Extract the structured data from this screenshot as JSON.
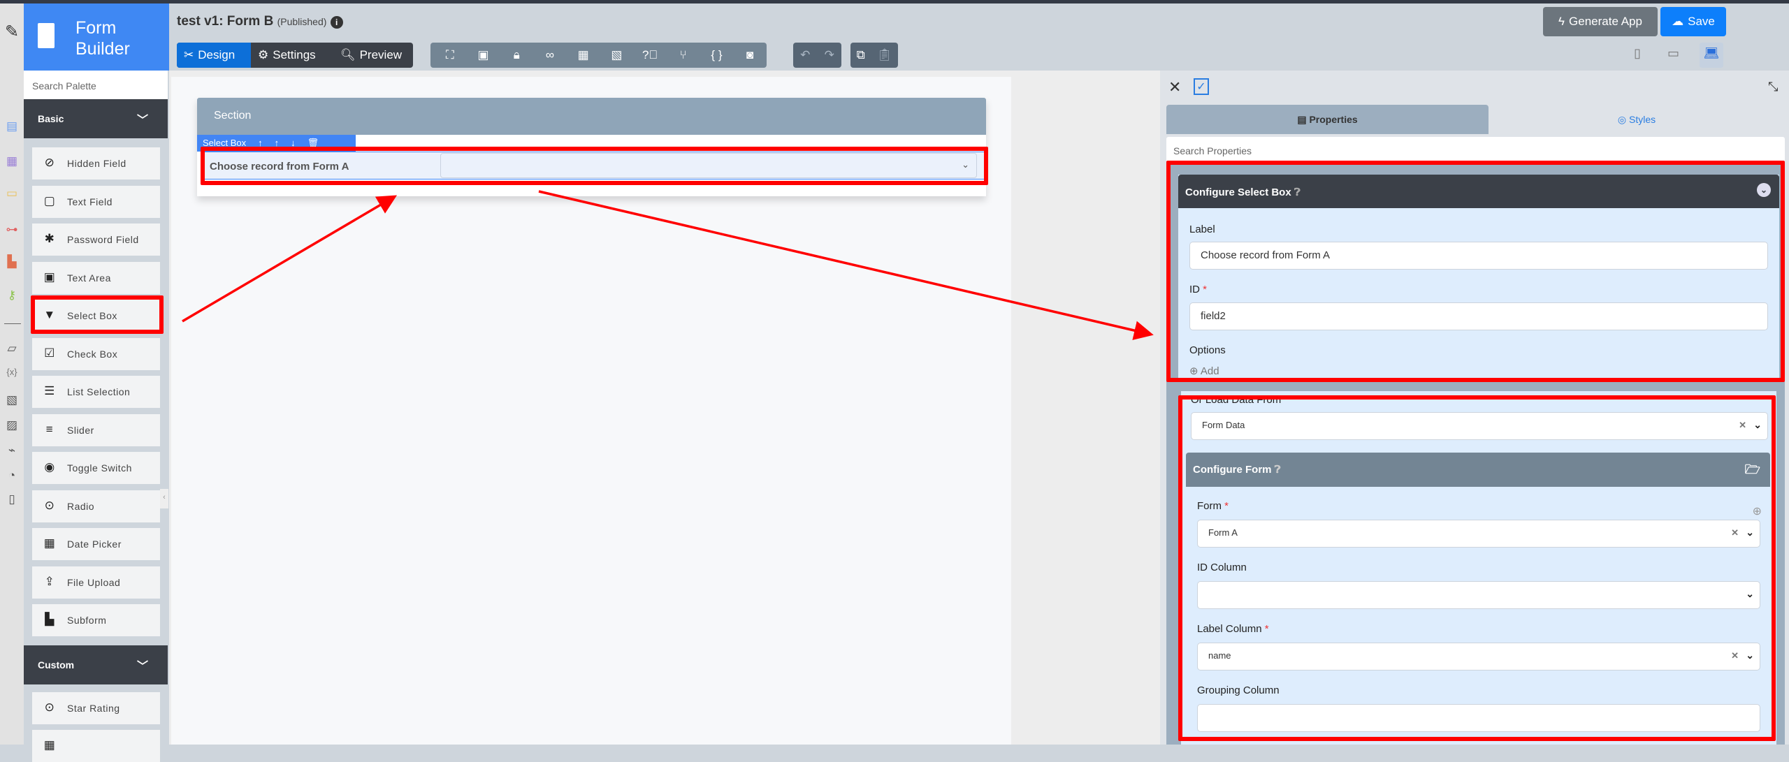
{
  "app": {
    "name_line1": "Form",
    "name_line2": "Builder",
    "title": "test v1: Form B",
    "status": "(Published)"
  },
  "header": {
    "modes": [
      "Design",
      "Settings",
      "Preview"
    ],
    "generate_label": "Generate App",
    "save_label": "Save"
  },
  "toolbar_icons": [
    "tree-icon",
    "properties-icon",
    "lock-icon",
    "binoculars-icon",
    "grid-icon",
    "translate-icon",
    "help-icon",
    "branch-icon",
    "braces-icon",
    "camera-icon"
  ],
  "palette": {
    "search_placeholder": "Search Palette",
    "categories": [
      {
        "label": "Basic"
      },
      {
        "label": "Custom"
      }
    ],
    "basic_items": [
      "Hidden Field",
      "Text Field",
      "Password Field",
      "Text Area",
      "Select Box",
      "Check Box",
      "List Selection",
      "Slider",
      "Toggle Switch",
      "Radio",
      "Date Picker",
      "File Upload",
      "Subform"
    ],
    "custom_items": [
      "Star Rating"
    ]
  },
  "canvas": {
    "section_label": "Section",
    "element_toolbar_label": "Select Box",
    "field_label": "Choose record from Form A"
  },
  "properties": {
    "tabs": [
      "Properties",
      "Styles"
    ],
    "search_placeholder": "Search Properties",
    "configure_title": "Configure Select Box",
    "label_label": "Label",
    "label_value": "Choose record from Form A",
    "id_label": "ID",
    "id_value": "field2",
    "options_label": "Options",
    "add_label": "Add",
    "load_label": "Or Load Data From",
    "load_value": "Form Data",
    "configure_form_title": "Configure Form",
    "form_label": "Form",
    "form_value": "Form A",
    "id_column_label": "ID Column",
    "id_column_value": "",
    "label_column_label": "Label Column",
    "label_column_value": "name",
    "grouping_label": "Grouping Column",
    "grouping_value": ""
  },
  "colors": {
    "accent": "#3f88f3",
    "highlight": "#ff0000",
    "dark": "#3b4048"
  }
}
